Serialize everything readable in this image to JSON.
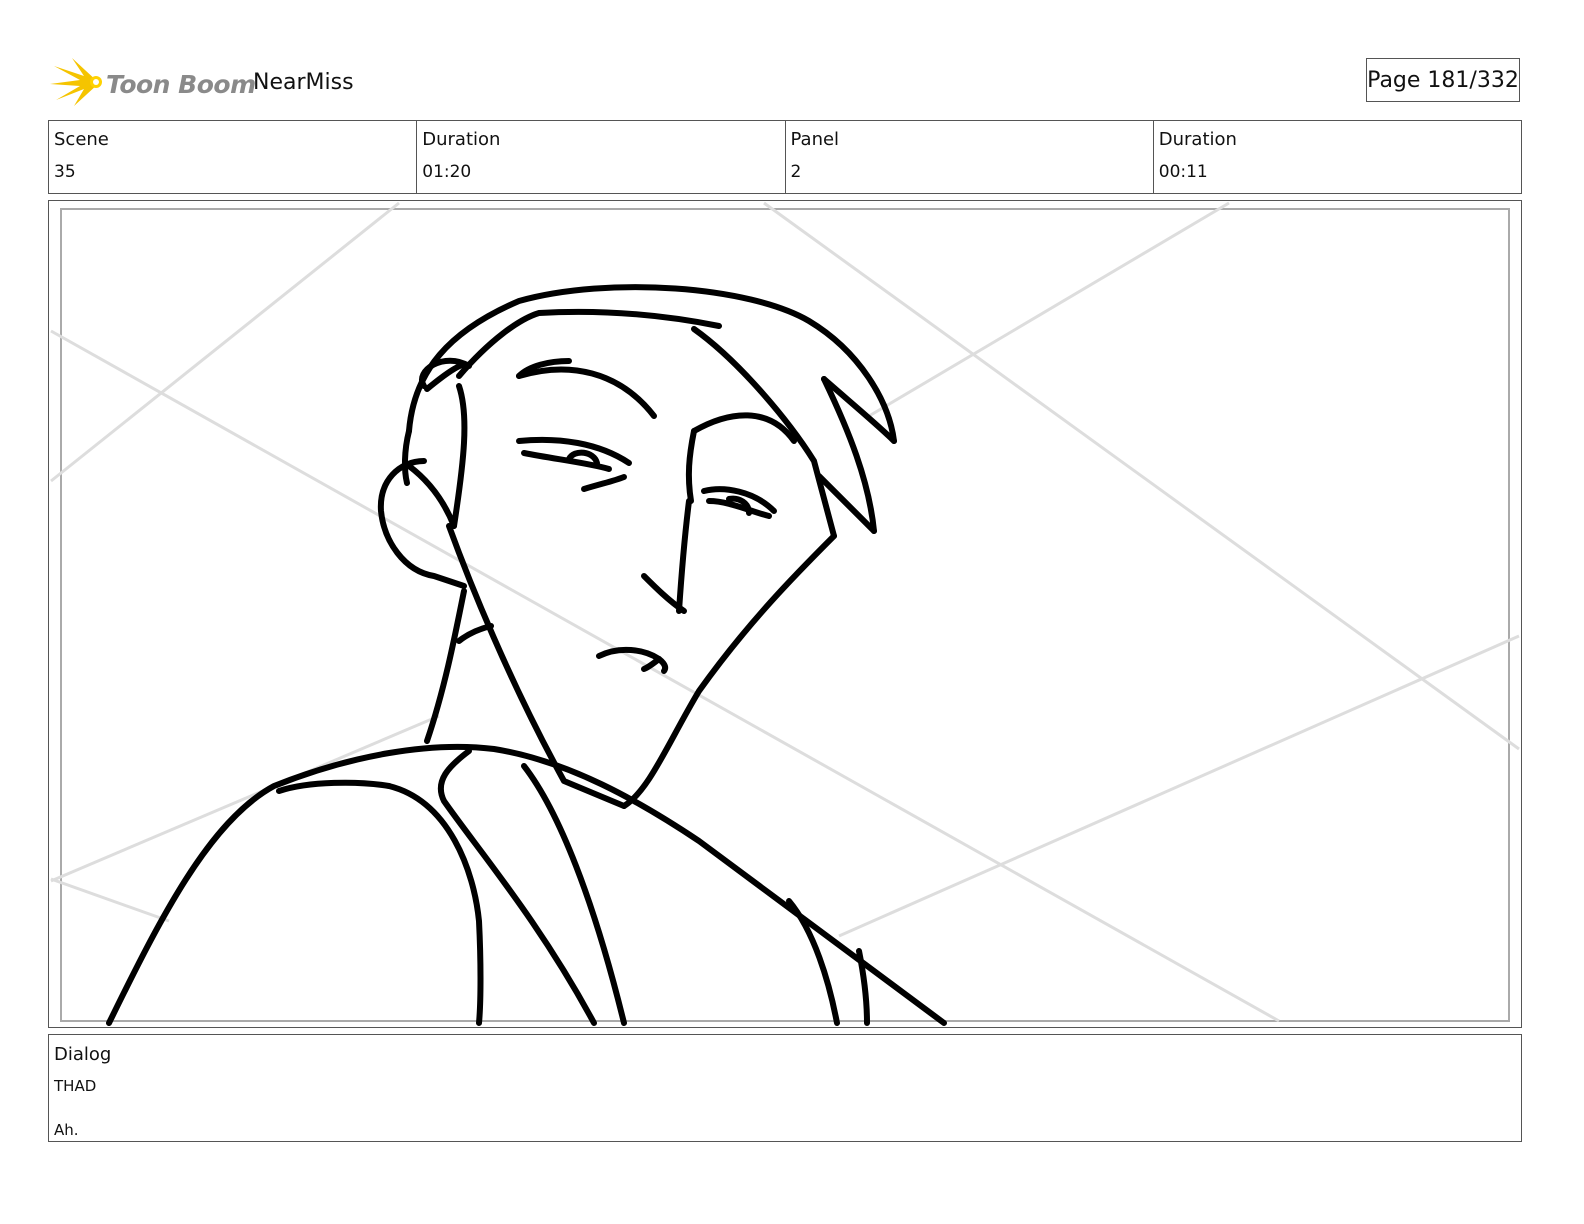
{
  "header": {
    "logo_text": "Toon Boom",
    "project_name": "NearMiss",
    "page_indicator": "Page 181/332"
  },
  "info": {
    "scene_label": "Scene",
    "scene_value": "35",
    "scene_duration_label": "Duration",
    "scene_duration_value": "01:20",
    "panel_label": "Panel",
    "panel_value": "2",
    "panel_duration_label": "Duration",
    "panel_duration_value": "00:11"
  },
  "dialog": {
    "label": "Dialog",
    "character": "THAD",
    "line": "Ah."
  },
  "colors": {
    "logo_accent": "#f5c400",
    "border": "#555555"
  }
}
